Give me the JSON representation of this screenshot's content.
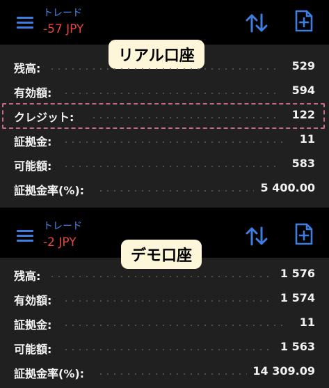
{
  "real": {
    "header": {
      "title": "トレード",
      "pnl": "-57 JPY"
    },
    "badge": "リアル口座",
    "rows": [
      {
        "label": "残高:",
        "value": "529"
      },
      {
        "label": "有効額:",
        "value": "594"
      },
      {
        "label": "クレジット:",
        "value": "122"
      },
      {
        "label": "証拠金:",
        "value": "11"
      },
      {
        "label": "可能額:",
        "value": "583"
      },
      {
        "label": "証拠金率(%):",
        "value": "5 400.00"
      }
    ]
  },
  "demo": {
    "header": {
      "title": "トレード",
      "pnl": "-2 JPY"
    },
    "badge": "デモ口座",
    "rows": [
      {
        "label": "残高:",
        "value": "1 576"
      },
      {
        "label": "有効額:",
        "value": "1 574"
      },
      {
        "label": "証拠金:",
        "value": "11"
      },
      {
        "label": "可能額:",
        "value": "1 563"
      },
      {
        "label": "証拠金率(%):",
        "value": "14 309.09"
      }
    ]
  },
  "icons": {
    "menu": "hamburger-menu-icon",
    "sort": "sort-arrows-icon",
    "new_order": "new-document-icon"
  },
  "colors": {
    "accent": "#3d7ee0",
    "loss": "#e6443c",
    "badge_bg": "#fdf6d8",
    "highlight_border": "#c96a86"
  }
}
